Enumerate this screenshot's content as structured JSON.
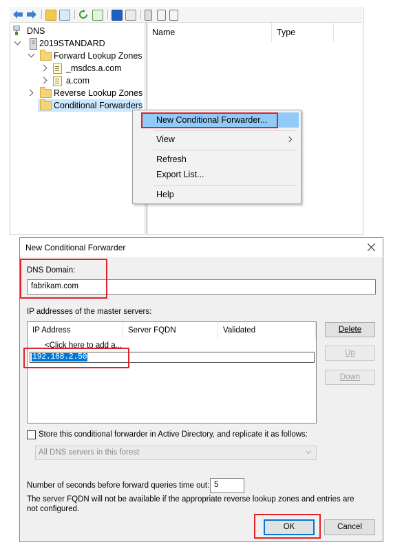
{
  "dns_manager": {
    "tree": {
      "root": "DNS",
      "server": "2019STANDARD",
      "forward_zones": "Forward Lookup Zones",
      "zone_msdcs": "_msdcs.a.com",
      "zone_a": "a.com",
      "reverse_zones": "Reverse Lookup Zones",
      "conditional_forwarders": "Conditional Forwarders"
    },
    "columns": [
      "Name",
      "Type"
    ]
  },
  "context_menu": {
    "items": [
      {
        "label": "New Conditional Forwarder...",
        "highlighted": true
      },
      {
        "label": "View",
        "submenu": true
      },
      {
        "label": "Refresh"
      },
      {
        "label": "Export List..."
      },
      {
        "label": "Help"
      }
    ]
  },
  "dialog": {
    "title": "New Conditional Forwarder",
    "dns_domain_label": "DNS Domain:",
    "dns_domain_value": "fabrikam.com",
    "ip_section_label": "IP addresses of the master servers:",
    "grid_columns": [
      "IP Address",
      "Server FQDN",
      "Validated"
    ],
    "add_row_placeholder": "<Click here to add a...",
    "ip_entry": "192.168.2.50",
    "buttons": {
      "delete": "Delete",
      "up": "Up",
      "down": "Down",
      "ok": "OK",
      "cancel": "Cancel"
    },
    "store_ad_label": "Store this conditional forwarder in Active Directory, and replicate it as follows:",
    "replication_scope": "All DNS servers in this forest",
    "timeout_label": "Number of seconds before forward queries time out:",
    "timeout_value": "5",
    "note": "The server FQDN will not be available if the appropriate reverse lookup zones and entries are not configured."
  },
  "colors": {
    "highlight": "#91c9f7",
    "callout": "#e0202a",
    "default_button": "#0078d7"
  }
}
